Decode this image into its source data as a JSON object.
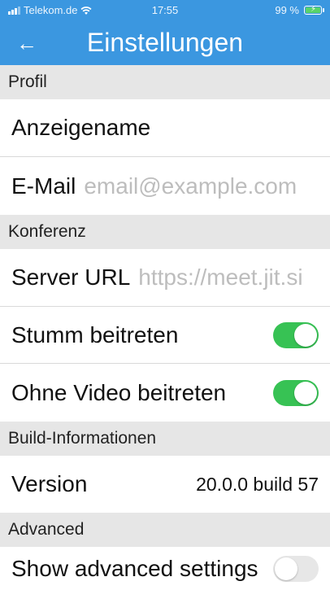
{
  "status_bar": {
    "carrier": "Telekom.de",
    "time": "17:55",
    "battery": "99 %"
  },
  "nav": {
    "back_icon": "arrow-left-icon",
    "title": "Einstellungen"
  },
  "colors": {
    "header_bg": "#3b97e0",
    "toggle_on": "#37c254",
    "section_bg": "#e6e6e6",
    "placeholder": "#bdbdbd"
  },
  "sections": {
    "profil": {
      "header": "Profil",
      "display_name_label": "Anzeigename",
      "display_name_value": "",
      "email_label": "E-Mail",
      "email_placeholder": "email@example.com"
    },
    "konferenz": {
      "header": "Konferenz",
      "server_label": "Server URL",
      "server_placeholder": "https://meet.jit.si",
      "mute_label": "Stumm beitreten",
      "mute_on": true,
      "novideo_label": "Ohne Video beitreten",
      "novideo_on": true
    },
    "build": {
      "header": "Build-Informationen",
      "version_label": "Version",
      "version_value": "20.0.0 build 57"
    },
    "advanced": {
      "header": "Advanced",
      "show_label": "Show advanced settings",
      "show_on": false
    }
  }
}
